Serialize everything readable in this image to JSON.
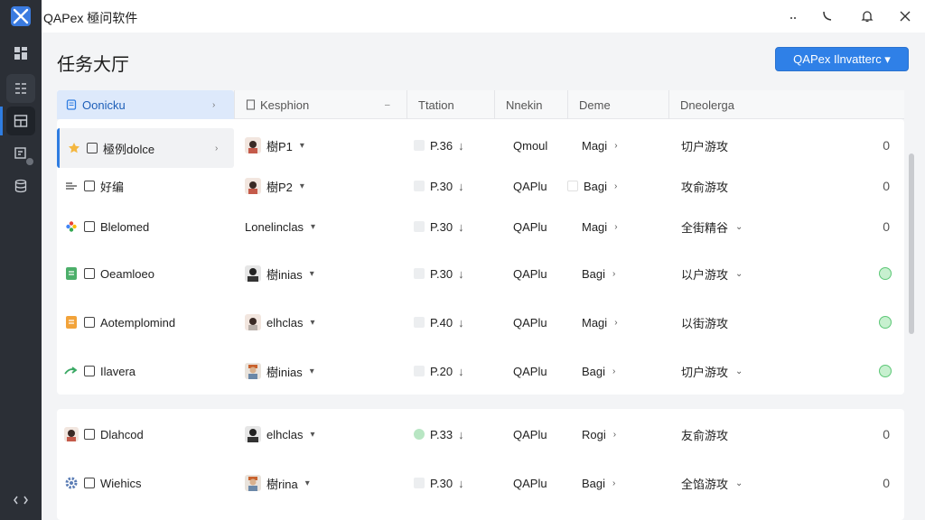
{
  "app": {
    "title": "QAPex 極问软件"
  },
  "page": {
    "title": "任务大厅"
  },
  "actions": {
    "primary_label": "QAPex Ilnvatterc ▾"
  },
  "colors": {
    "accent": "#2f80e7",
    "sidebar": "#2b2f36",
    "ok": "#5cc776"
  },
  "columns": [
    "Oonicku",
    "Kesphion",
    "Ttation",
    "Nnekin",
    "Deme",
    "Dneolerga"
  ],
  "rows": [
    {
      "icon": "star-icon",
      "name": "極例dolce",
      "assignee": "樹P1",
      "rate": "P.36",
      "rate_mark": "↓",
      "tag": "Qmoul",
      "type": "Magi",
      "stage": "切户游攻",
      "count": "0"
    },
    {
      "icon": "list-icon",
      "name": "好编",
      "assignee": "樹P2",
      "rate": "P.30",
      "rate_mark": "↓",
      "tag": "QAPlu",
      "type": "Bagi",
      "stage": "攻俞游攻",
      "count": "0"
    },
    {
      "icon": "flower-icon",
      "name": "Blelomed",
      "assignee": "Lonelinclas",
      "rate": "P.30",
      "rate_mark": "↓",
      "tag": "QAPlu",
      "type": "Magi",
      "stage": "全街精谷",
      "count": "0"
    },
    {
      "icon": "doc-green-icon",
      "name": "Oeamloeo",
      "assignee": "樹inias",
      "rate": "P.30",
      "rate_mark": "↓",
      "tag": "QAPlu",
      "type": "Bagi",
      "stage": "以户游攻",
      "status": "ok"
    },
    {
      "icon": "doc-orange-icon",
      "name": "Aotemplomind",
      "assignee": "elhclas",
      "rate": "P.40",
      "rate_mark": "↓",
      "tag": "QAPlu",
      "type": "Magi",
      "stage": "以街游攻",
      "status": "ok"
    },
    {
      "icon": "arrow-icon",
      "name": "Ilavera",
      "assignee": "樹inias",
      "rate": "P.20",
      "rate_mark": "↓",
      "tag": "QAPlu",
      "type": "Bagi",
      "stage": "切户游攻",
      "status": "ok"
    },
    {
      "icon": "person-icon",
      "name": "Dlahcod",
      "assignee": "elhclas",
      "rate": "P.33",
      "rate_mark": "↓",
      "tag": "QAPlu",
      "type": "Rogi",
      "stage": "友俞游攻",
      "count": "0"
    },
    {
      "icon": "gear-icon",
      "name": "Wiehics",
      "assignee": "樹rina",
      "rate": "P.30",
      "rate_mark": "↓",
      "tag": "QAPlu",
      "type": "Bagi",
      "stage": "全馅游攻",
      "count": "0"
    }
  ]
}
